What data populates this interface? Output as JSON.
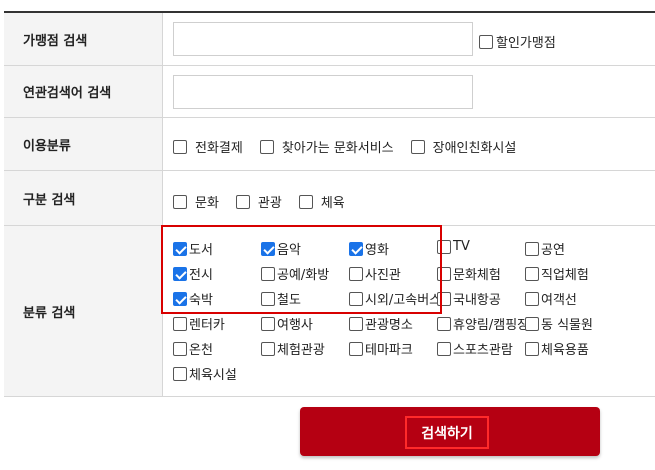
{
  "form": {
    "merchant_search": {
      "label": "가맹점 검색",
      "value": "",
      "discount_label": "할인가맹점",
      "discount_checked": false
    },
    "related_search": {
      "label": "연관검색어 검색",
      "value": ""
    },
    "usage_class": {
      "label": "이용분류",
      "options": [
        {
          "label": "전화결제",
          "checked": false
        },
        {
          "label": "찾아가는 문화서비스",
          "checked": false
        },
        {
          "label": "장애인친화시설",
          "checked": false
        }
      ]
    },
    "division_search": {
      "label": "구분 검색",
      "options": [
        {
          "label": "문화",
          "checked": false
        },
        {
          "label": "관광",
          "checked": false
        },
        {
          "label": "체육",
          "checked": false
        }
      ]
    },
    "category_search": {
      "label": "분류 검색",
      "options": [
        {
          "label": "도서",
          "checked": true
        },
        {
          "label": "음악",
          "checked": true
        },
        {
          "label": "영화",
          "checked": true
        },
        {
          "label": "TV",
          "checked": false
        },
        {
          "label": "공연",
          "checked": false
        },
        {
          "label": "전시",
          "checked": true
        },
        {
          "label": "공예/화방",
          "checked": false
        },
        {
          "label": "사진관",
          "checked": false
        },
        {
          "label": "문화체험",
          "checked": false
        },
        {
          "label": "직업체험",
          "checked": false
        },
        {
          "label": "숙박",
          "checked": true
        },
        {
          "label": "철도",
          "checked": false
        },
        {
          "label": "시외/고속버스",
          "checked": false
        },
        {
          "label": "국내항공",
          "checked": false
        },
        {
          "label": "여객선",
          "checked": false
        },
        {
          "label": "렌터카",
          "checked": false
        },
        {
          "label": "여행사",
          "checked": false
        },
        {
          "label": "관광명소",
          "checked": false
        },
        {
          "label": "휴양림/캠핑장",
          "checked": false
        },
        {
          "label": "동 식물원",
          "checked": false
        },
        {
          "label": "온천",
          "checked": false
        },
        {
          "label": "체험관광",
          "checked": false
        },
        {
          "label": "테마파크",
          "checked": false
        },
        {
          "label": "스포츠관람",
          "checked": false
        },
        {
          "label": "체육용품",
          "checked": false
        },
        {
          "label": "체육시설",
          "checked": false
        }
      ]
    }
  },
  "search_button": {
    "label": "검색하기"
  },
  "colors": {
    "accent": "#b50012",
    "check": "#1a73e8",
    "highlight": "#d80000"
  }
}
